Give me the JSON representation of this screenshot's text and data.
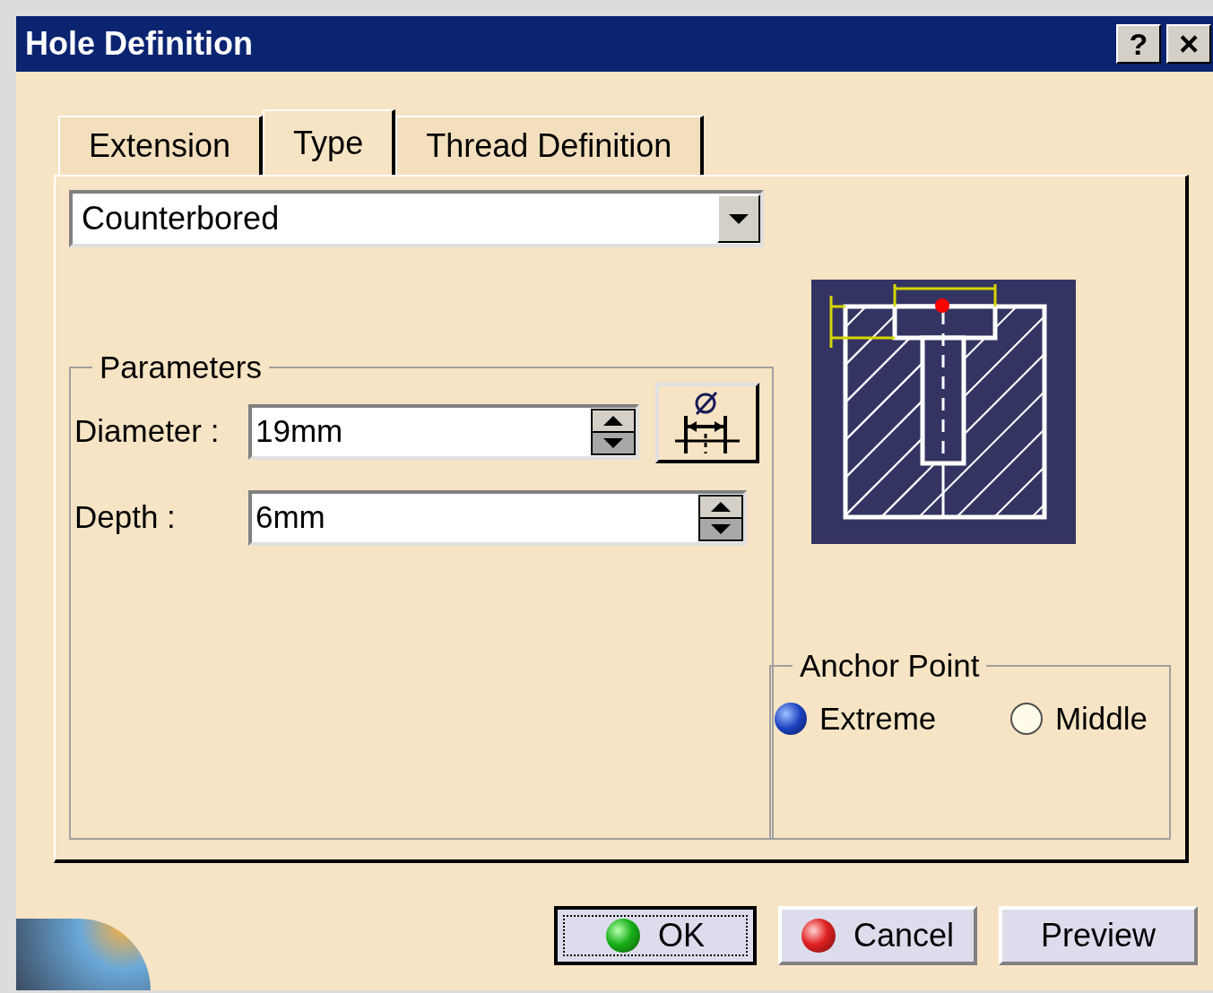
{
  "window": {
    "title": "Hole Definition",
    "help": "?",
    "close": "×"
  },
  "tabs": [
    {
      "label": "Extension",
      "selected": false
    },
    {
      "label": "Type",
      "selected": true
    },
    {
      "label": "Thread Definition",
      "selected": false
    }
  ],
  "type_dropdown": {
    "value": "Counterbored"
  },
  "parameters": {
    "title": "Parameters",
    "fields": [
      {
        "label": "Diameter :",
        "value": "19mm",
        "kind": "diameter"
      },
      {
        "label": "Depth :",
        "value": "6mm",
        "kind": "plain"
      }
    ]
  },
  "anchor_point": {
    "title": "Anchor Point",
    "options": [
      {
        "label": "Extreme",
        "selected": true
      },
      {
        "label": "Middle",
        "selected": false
      }
    ]
  },
  "buttons": [
    {
      "label": "OK",
      "kind": "ok"
    },
    {
      "label": "Cancel",
      "kind": "cancel"
    },
    {
      "label": "Preview",
      "kind": "plain"
    }
  ]
}
